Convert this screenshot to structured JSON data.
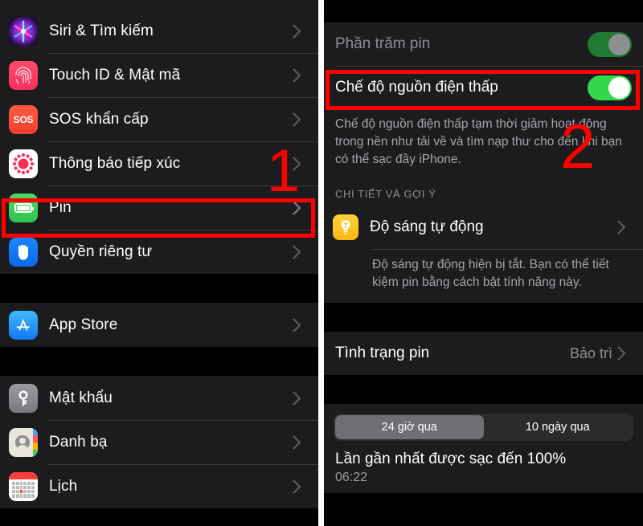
{
  "annotations": {
    "step1": "1",
    "step2": "2",
    "highlight_color": "#fe0000"
  },
  "left_panel": {
    "groups": [
      {
        "rows": [
          {
            "icon": "siri-icon",
            "label": "Siri & Tìm kiếm",
            "chevron": true
          },
          {
            "icon": "touchid-icon",
            "label": "Touch ID & Mật mã",
            "chevron": true
          },
          {
            "icon": "sos-icon",
            "label": "SOS khẩn cấp",
            "chevron": true
          },
          {
            "icon": "exposure-icon",
            "label": "Thông báo tiếp xúc",
            "chevron": true
          },
          {
            "icon": "battery-icon",
            "label": "Pin",
            "chevron": true
          },
          {
            "icon": "privacy-icon",
            "label": "Quyền riêng tư",
            "chevron": true
          }
        ]
      },
      {
        "rows": [
          {
            "icon": "appstore-icon",
            "label": "App Store",
            "chevron": true
          }
        ]
      },
      {
        "rows": [
          {
            "icon": "password-icon",
            "label": "Mật khẩu",
            "chevron": true
          },
          {
            "icon": "contacts-icon",
            "label": "Danh bạ",
            "chevron": true
          },
          {
            "icon": "calendar-icon",
            "label": "Lịch",
            "chevron": true
          }
        ]
      }
    ],
    "sos_icon_text": "SOS"
  },
  "right_panel": {
    "battery_percentage": {
      "label": "Phần trăm pin",
      "toggle_state": "on-dimmed"
    },
    "low_power_mode": {
      "label": "Chế độ nguồn điện thấp",
      "toggle_state": "on"
    },
    "low_power_description": "Chế độ nguồn điện thấp tạm thời giảm hoạt động trong nền như tải về và tìm nạp thư cho đến khi bạn có thể sạc đầy iPhone.",
    "section_header": "CHI TIẾT VÀ GỢI Ý",
    "auto_brightness": {
      "icon": "bulb-icon",
      "label": "Độ sáng tự động",
      "chevron": true,
      "description": "Độ sáng tự động hiện bị tắt. Bạn có thể tiết kiệm pin bằng cách bật tính năng này."
    },
    "battery_health": {
      "label": "Tình trạng pin",
      "value": "Bảo trì",
      "chevron": true
    },
    "segmented_control": {
      "options": [
        "24 giờ qua",
        "10 ngày qua"
      ],
      "selected_index": 0
    },
    "last_charge": {
      "title": "Lần gần nhất được sạc đến 100%",
      "time": "06:22"
    }
  }
}
